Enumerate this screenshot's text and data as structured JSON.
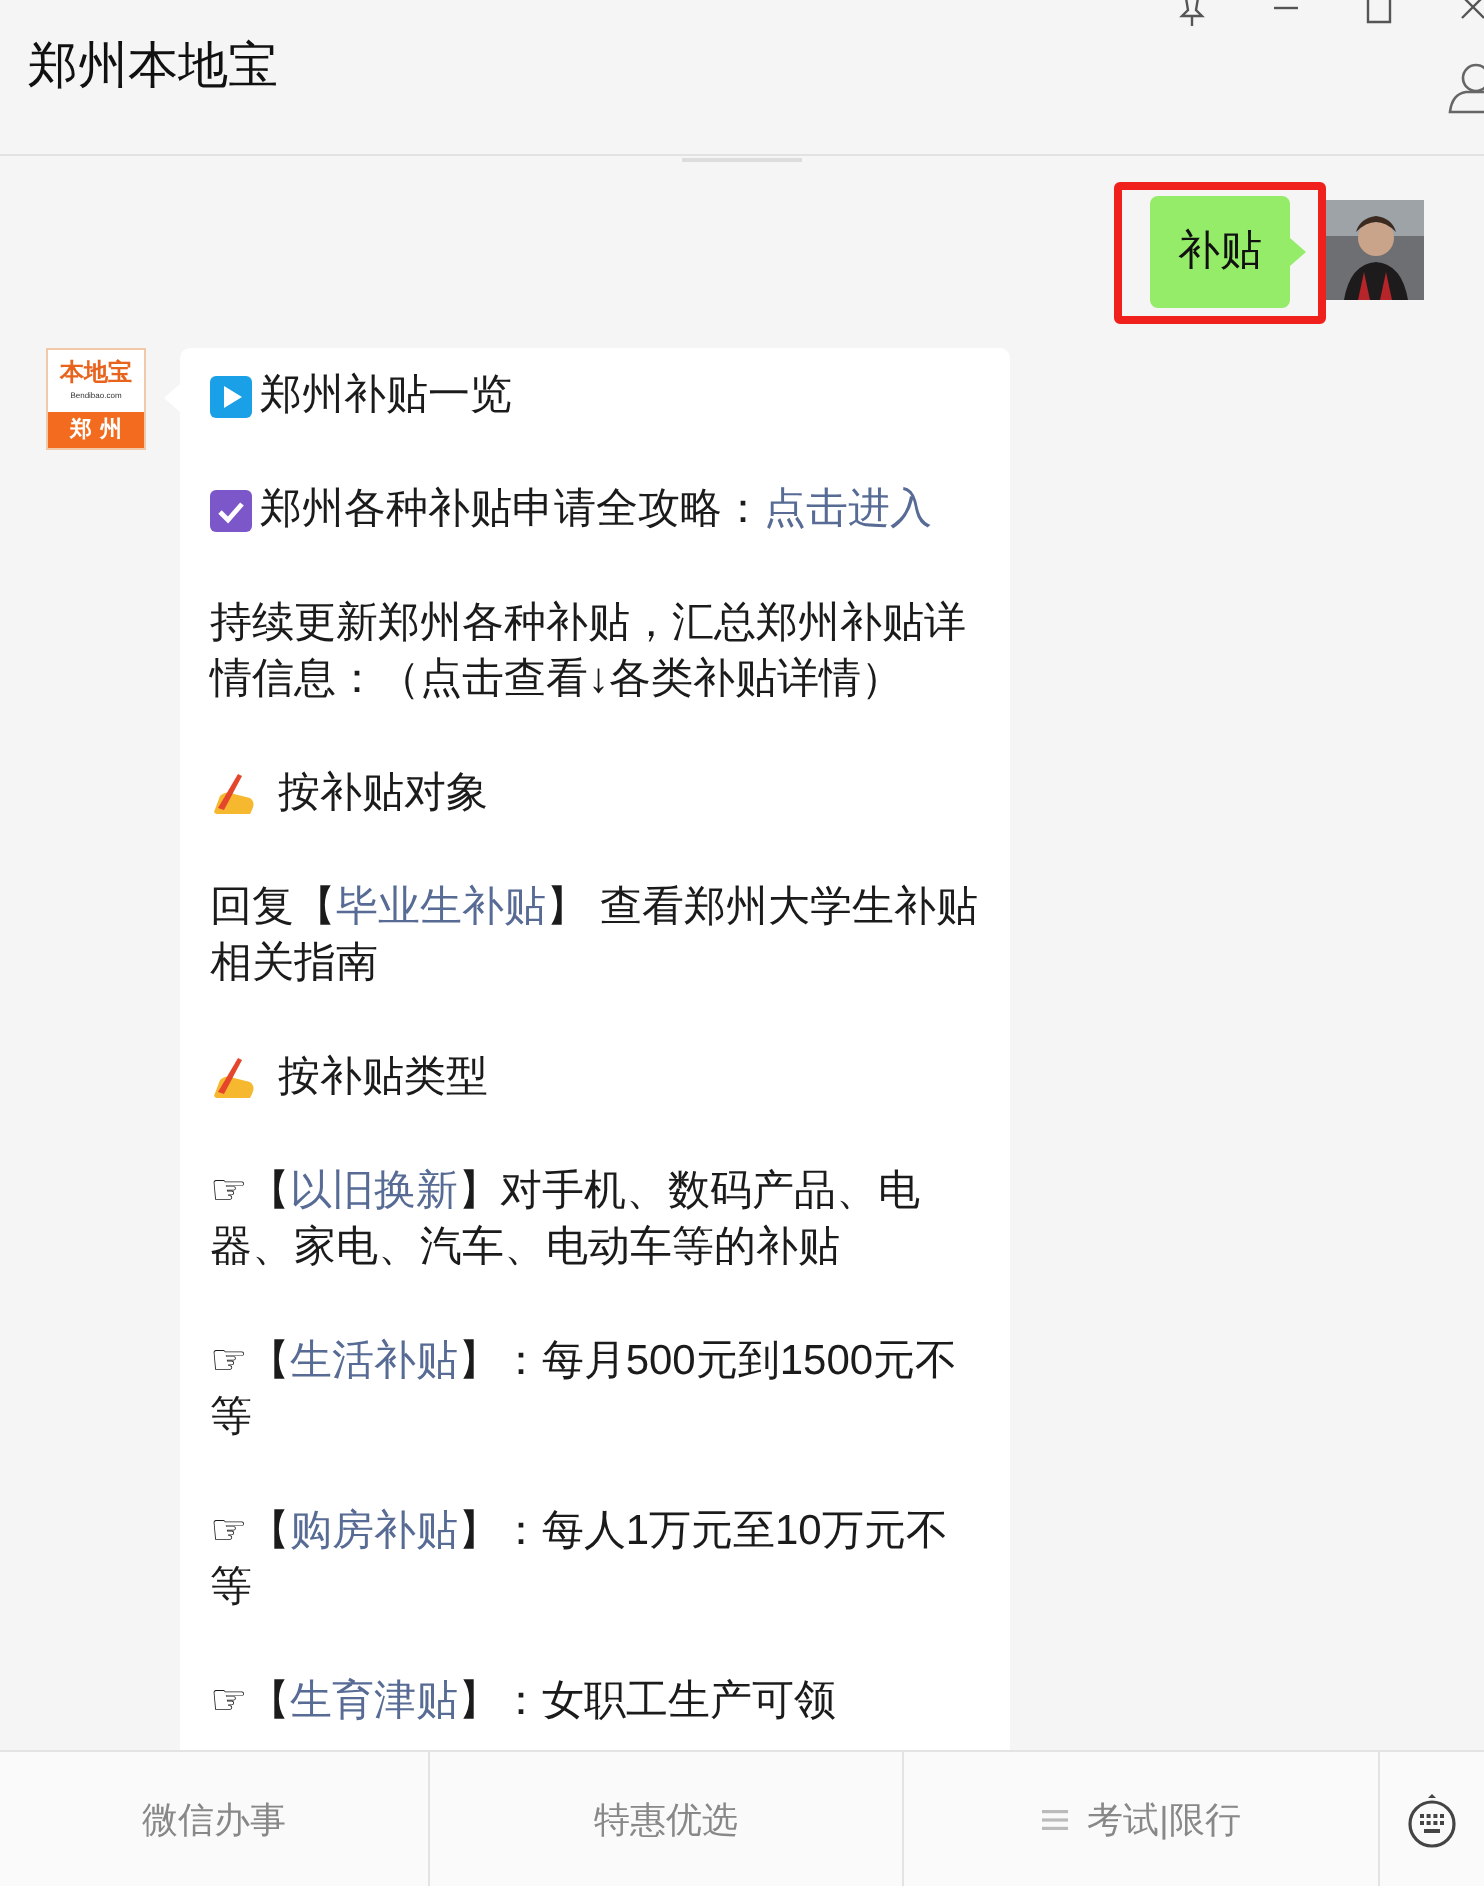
{
  "window": {
    "title": "郑州本地宝"
  },
  "messages": [
    {
      "kind": "sent",
      "text": "补贴",
      "highlighted": true
    },
    {
      "kind": "received",
      "logo": {
        "top": "本地宝",
        "domain": "Bendibao.com",
        "bottom": "郑州"
      },
      "paragraphs": [
        {
          "kind": "play",
          "segments": [
            {
              "kind": "plain",
              "text": "郑州补贴一览"
            }
          ]
        },
        {
          "kind": "check",
          "segments": [
            {
              "kind": "plain",
              "text": "郑州各种补贴申请全攻略："
            },
            {
              "kind": "link",
              "text": "点击进入"
            }
          ]
        },
        {
          "segments": [
            {
              "kind": "plain",
              "text": "持续更新郑州各种补贴，汇总郑州补贴详情信息：（点击查看↓各类补贴详情）"
            }
          ]
        },
        {
          "kind": "writing-hand",
          "segments": [
            {
              "kind": "plain",
              "text": "按补贴对象"
            }
          ]
        },
        {
          "segments": [
            {
              "kind": "plain",
              "text": "回复【"
            },
            {
              "kind": "link",
              "text": "毕业生补贴"
            },
            {
              "kind": "plain",
              "text": "】 查看郑州大学生补贴相关指南"
            }
          ]
        },
        {
          "kind": "writing-hand",
          "segments": [
            {
              "kind": "plain",
              "text": "按补贴类型"
            }
          ]
        },
        {
          "segments": [
            {
              "kind": "plain",
              "text": "☞【"
            },
            {
              "kind": "link",
              "text": "以旧换新"
            },
            {
              "kind": "plain",
              "text": "】对手机、数码产品、电器、家电、汽车、电动车等的补贴"
            }
          ]
        },
        {
          "segments": [
            {
              "kind": "plain",
              "text": "☞【"
            },
            {
              "kind": "link",
              "text": "生活补贴"
            },
            {
              "kind": "plain",
              "text": "】：每月500元到1500元不等"
            }
          ]
        },
        {
          "segments": [
            {
              "kind": "plain",
              "text": "☞【"
            },
            {
              "kind": "link",
              "text": "购房补贴"
            },
            {
              "kind": "plain",
              "text": "】：每人1万元至10万元不等"
            }
          ]
        },
        {
          "segments": [
            {
              "kind": "plain",
              "text": "☞【"
            },
            {
              "kind": "link",
              "text": "生育津贴"
            },
            {
              "kind": "plain",
              "text": "】：女职工生产可领"
            }
          ]
        }
      ]
    }
  ],
  "bottom_menu": [
    {
      "label": "微信办事"
    },
    {
      "label": "特惠优选"
    },
    {
      "label": "考试|限行",
      "kind": "menu"
    }
  ]
}
